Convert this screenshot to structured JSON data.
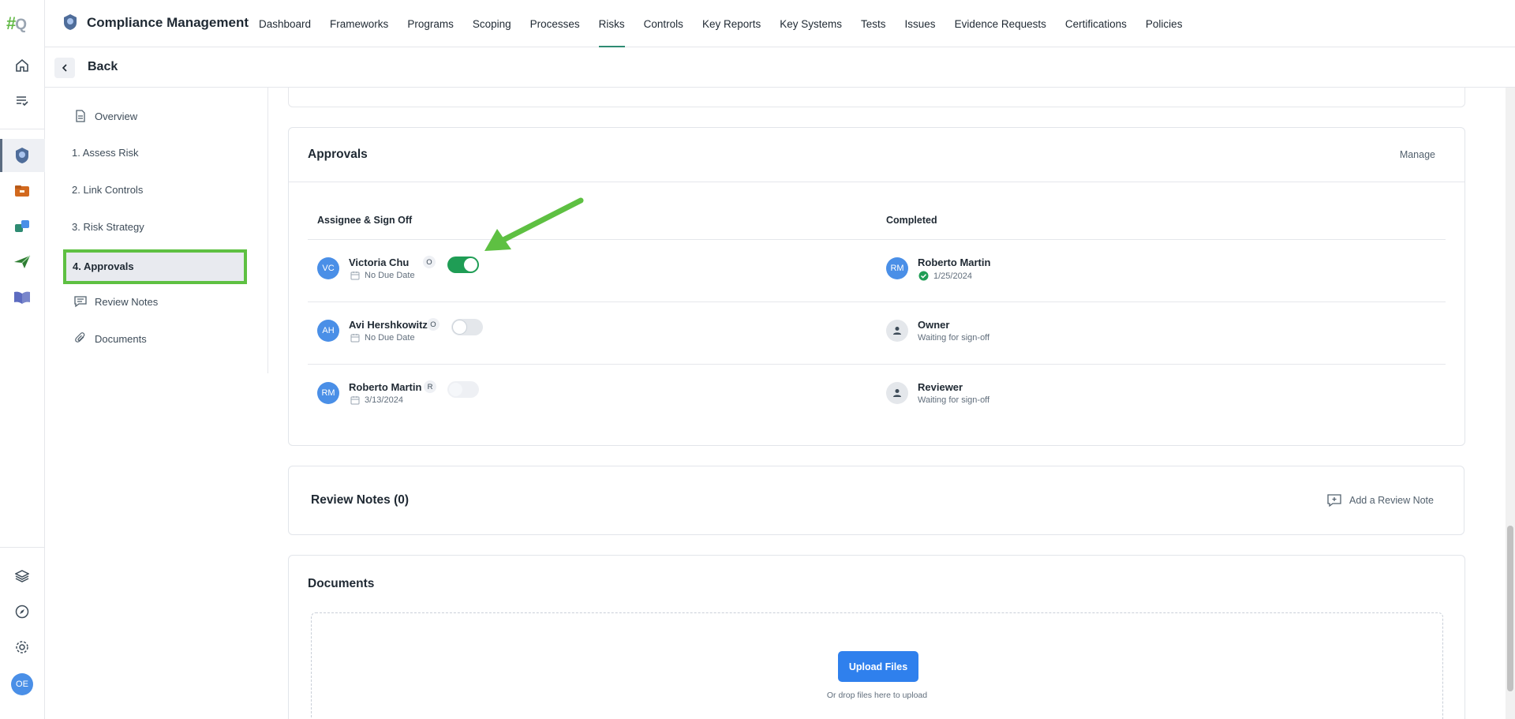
{
  "app": {
    "logo_main": "#",
    "logo_sub": "Q",
    "title": "Compliance Management",
    "user_initials": "OE"
  },
  "nav": {
    "items": [
      {
        "label": "Dashboard",
        "active": false
      },
      {
        "label": "Frameworks",
        "active": false
      },
      {
        "label": "Programs",
        "active": false
      },
      {
        "label": "Scoping",
        "active": false
      },
      {
        "label": "Processes",
        "active": false
      },
      {
        "label": "Risks",
        "active": true
      },
      {
        "label": "Controls",
        "active": false
      },
      {
        "label": "Key Reports",
        "active": false
      },
      {
        "label": "Key Systems",
        "active": false
      },
      {
        "label": "Tests",
        "active": false
      },
      {
        "label": "Issues",
        "active": false
      },
      {
        "label": "Evidence Requests",
        "active": false
      },
      {
        "label": "Certifications",
        "active": false
      },
      {
        "label": "Policies",
        "active": false
      }
    ]
  },
  "back": {
    "label": "Back"
  },
  "sidenav": {
    "overview": "Overview",
    "assess": "1. Assess Risk",
    "link": "2. Link Controls",
    "strategy": "3. Risk Strategy",
    "approvals": "4. Approvals",
    "review_notes": "Review Notes",
    "documents": "Documents"
  },
  "approvals": {
    "title": "Approvals",
    "manage": "Manage",
    "col_assignee": "Assignee & Sign Off",
    "col_completed": "Completed",
    "rows": [
      {
        "initials": "VC",
        "name": "Victoria Chu",
        "role": "O",
        "due": "No Due Date",
        "signed": true,
        "completed_initials": "RM",
        "completed_title": "Roberto Martin",
        "completed_sub": "1/25/2024"
      },
      {
        "initials": "AH",
        "name": "Avi Hershkowitz",
        "role": "O",
        "due": "No Due Date",
        "signed": false,
        "completed_title": "Owner",
        "completed_sub": "Waiting for sign-off"
      },
      {
        "initials": "RM",
        "name": "Roberto Martin",
        "role": "R",
        "due": "3/13/2024",
        "signed": false,
        "completed_title": "Reviewer",
        "completed_sub": "Waiting for sign-off"
      }
    ]
  },
  "review_notes": {
    "title": "Review Notes (0)",
    "add": "Add a Review Note"
  },
  "documents": {
    "title": "Documents",
    "upload": "Upload Files",
    "hint": "Or drop files here to upload"
  },
  "colors": {
    "accent": "#2e8b72",
    "toggle_on": "#1f9d55",
    "primary_button": "#2f80ed",
    "avatar": "#4a8fe7",
    "highlight": "#5ec042"
  }
}
